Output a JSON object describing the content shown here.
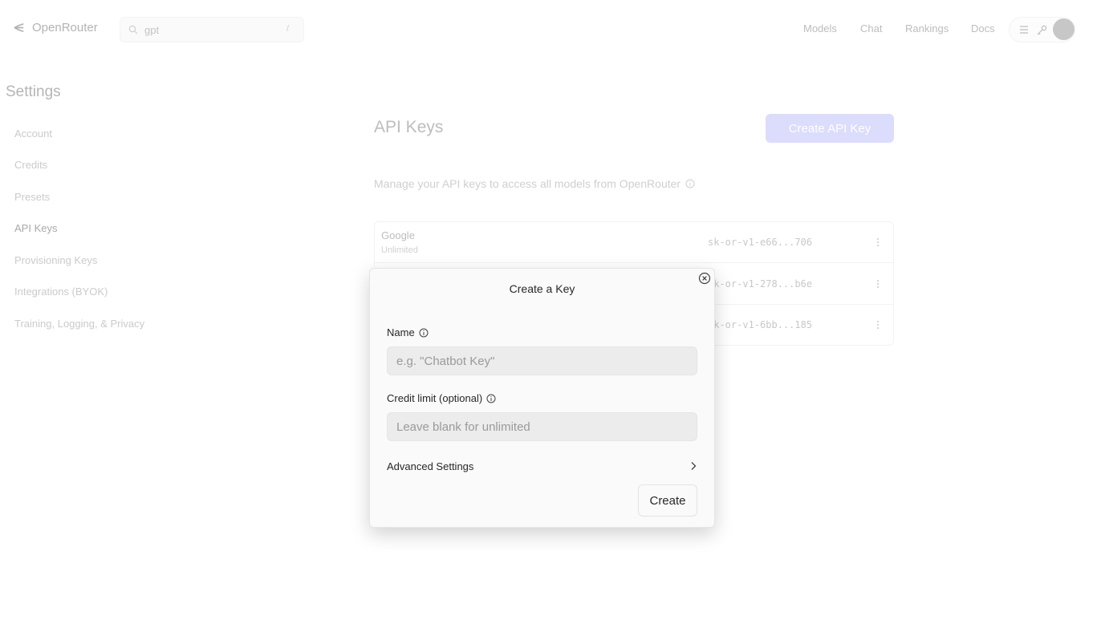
{
  "header": {
    "logo_text": "OpenRouter",
    "search_value": "gpt",
    "search_shortcut": "/",
    "nav": [
      "Models",
      "Chat",
      "Rankings",
      "Docs"
    ]
  },
  "sidebar": {
    "title": "Settings",
    "items": [
      {
        "label": "Account"
      },
      {
        "label": "Credits"
      },
      {
        "label": "Presets"
      },
      {
        "label": "API Keys"
      },
      {
        "label": "Provisioning Keys"
      },
      {
        "label": "Integrations (BYOK)"
      },
      {
        "label": "Training, Logging, & Privacy"
      }
    ]
  },
  "main": {
    "title": "API Keys",
    "create_button": "Create API Key",
    "subtitle": "Manage your API keys to access all models from OpenRouter",
    "keys": [
      {
        "name": "Google",
        "limit": "Unlimited",
        "value": "sk-or-v1-e66...706"
      },
      {
        "name": "",
        "limit": "",
        "value": "sk-or-v1-278...b6e"
      },
      {
        "name": "",
        "limit": "",
        "value": "sk-or-v1-6bb...185"
      }
    ]
  },
  "modal": {
    "title": "Create a Key",
    "name_label": "Name",
    "name_placeholder": "e.g. \"Chatbot Key\"",
    "name_value": "",
    "credit_label": "Credit limit (optional)",
    "credit_placeholder": "Leave blank for unlimited",
    "credit_value": "",
    "advanced_label": "Advanced Settings",
    "create_label": "Create"
  },
  "colors": {
    "accent_disabled": "#dcdcfc",
    "modal_bg": "#fafafa",
    "field_bg": "#ececec"
  }
}
